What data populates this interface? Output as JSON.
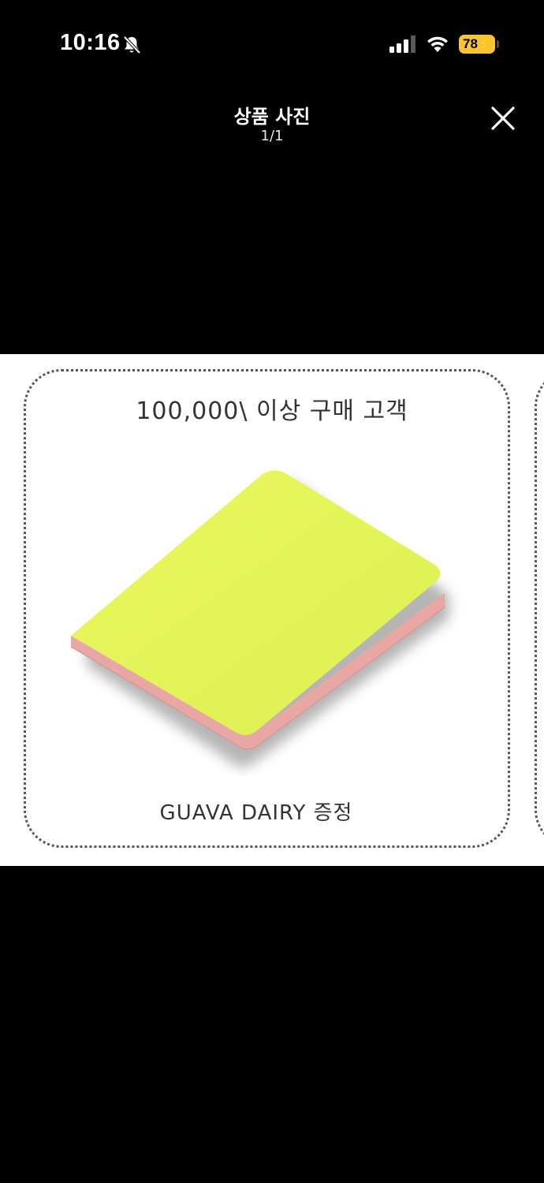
{
  "status_bar": {
    "time": "10:16",
    "battery": "78",
    "icons": [
      "bell-slash-icon",
      "cellular-signal-icon",
      "wifi-icon",
      "battery-icon"
    ],
    "battery_color": "#f7c531"
  },
  "header": {
    "title": "상품 사진",
    "counter": "1/1",
    "close_icon": "close-icon"
  },
  "photo": {
    "promo_text": "100,000\\ 이상 구매 고객",
    "gift_text": "GUAVA DAIRY 증정",
    "cover_color": "#e6f75a",
    "edge_color": "#e8a7a3"
  }
}
